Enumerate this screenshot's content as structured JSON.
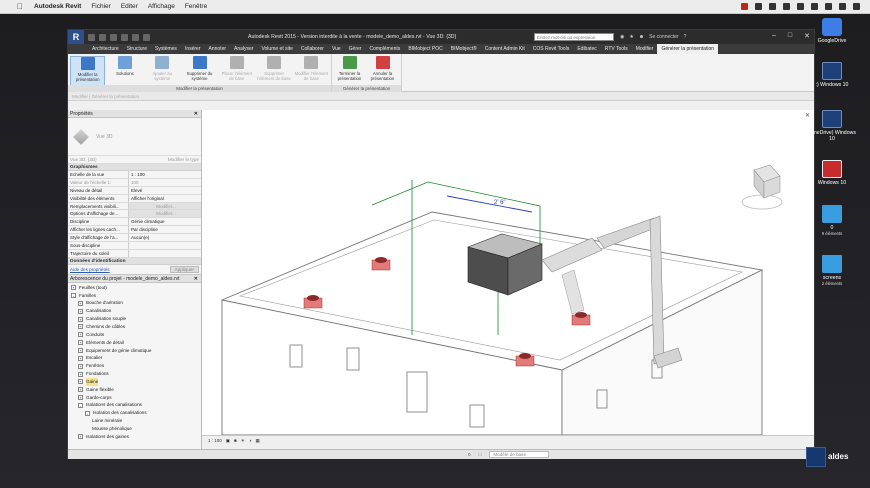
{
  "mac_menu": {
    "app_name": "Autodesk Revit",
    "items": [
      "Fichier",
      "Editer",
      "Affichage",
      "Fenêtre"
    ]
  },
  "window": {
    "title": "Autodesk Revit 2015 - Version interdite à la vente -     modele_demo_aldes.rvt - Vue 3D: {3D}",
    "search_placeholder": "Entrez mot-clé ou expression",
    "signin_label": "Se connecter"
  },
  "ribbon_tabs": [
    "Architecture",
    "Structure",
    "Systèmes",
    "Insérer",
    "Annoter",
    "Analyser",
    "Volume et site",
    "Collaborer",
    "Vue",
    "Gérer",
    "Compléments",
    "BIMobject POC",
    "BIMobject®",
    "Content Admin Kit",
    "COS Revit Tools",
    "Edibatec",
    "RTV Tools",
    "Modifier",
    "Générer la présentation"
  ],
  "active_tab_index": 18,
  "ribbon": {
    "group1": {
      "label": "Modifier la présentation",
      "buttons": [
        {
          "label": "Modifier la présentation",
          "enabled": true,
          "selected": true
        },
        {
          "label": "Solutions",
          "enabled": true
        },
        {
          "label": "Ajouter au système",
          "enabled": false
        },
        {
          "label": "Supprimer du système",
          "enabled": true
        },
        {
          "label": "Placer l'élément de base",
          "enabled": false
        },
        {
          "label": "Supprimer l'élément de base",
          "enabled": false
        },
        {
          "label": "Modifier l'élément de base",
          "enabled": false
        }
      ]
    },
    "group2": {
      "label": "Générer la présentation",
      "buttons": [
        {
          "label": "Terminer la présentation",
          "enabled": true
        },
        {
          "label": "Annuler la présentation",
          "enabled": true
        }
      ]
    },
    "options_bar": "Modifier | Générer la présentation"
  },
  "properties": {
    "header": "Propriétés",
    "type_name": "Vue 3D",
    "view_selector": "Vue 3D: {3D}",
    "edit_type_label": "Modifier le type",
    "sections": {
      "graphics": "Graphismes",
      "extents": "Données d'identification"
    },
    "rows": [
      {
        "k": "Echelle de la vue",
        "v": "1 : 100"
      },
      {
        "k": "Valeur de l'échelle   1:",
        "v": "100",
        "dim": true
      },
      {
        "k": "Niveau de détail",
        "v": "Elevé"
      },
      {
        "k": "Visibilité des éléments",
        "v": "Afficher l'original"
      },
      {
        "k": "Remplacements visibili...",
        "v": "Modifier...",
        "btn": true
      },
      {
        "k": "Options d'affichage de...",
        "v": "Modifier...",
        "btn": true
      },
      {
        "k": "Discipline",
        "v": "Génie climatique"
      },
      {
        "k": "Afficher les lignes cach...",
        "v": "Par discipline"
      },
      {
        "k": "Style d'affichage de l'a...",
        "v": "Aucun(e)"
      },
      {
        "k": "Sous-discipline",
        "v": ""
      },
      {
        "k": "Trajectoire du soleil",
        "v": ""
      }
    ],
    "help_link": "Aide des propriétés",
    "apply_label": "Appliquer"
  },
  "browser": {
    "header": "Arborescence du projet - modele_demo_aldes.rvt",
    "items": [
      {
        "label": "Feuilles (tout)",
        "level": 0,
        "tog": "+"
      },
      {
        "label": "Familles",
        "level": 0,
        "tog": "-"
      },
      {
        "label": "Bouche d'aération",
        "level": 1,
        "tog": "+"
      },
      {
        "label": "Canalisation",
        "level": 1,
        "tog": "+"
      },
      {
        "label": "Canalisation souple",
        "level": 1,
        "tog": "+"
      },
      {
        "label": "Chemins de câbles",
        "level": 1,
        "tog": "+"
      },
      {
        "label": "Conduits",
        "level": 1,
        "tog": "+"
      },
      {
        "label": "Eléments de détail",
        "level": 1,
        "tog": "+"
      },
      {
        "label": "Equipement de génie climatique",
        "level": 1,
        "tog": "+"
      },
      {
        "label": "Escalier",
        "level": 1,
        "tog": "+"
      },
      {
        "label": "Fenêtres",
        "level": 1,
        "tog": "+"
      },
      {
        "label": "Fondations",
        "level": 1,
        "tog": "+"
      },
      {
        "label": "Gaine",
        "level": 1,
        "tog": "+",
        "sel": true
      },
      {
        "label": "Gaine flexible",
        "level": 1,
        "tog": "+"
      },
      {
        "label": "Garde-corps",
        "level": 1,
        "tog": "+"
      },
      {
        "label": "Isolations des canalisations",
        "level": 1,
        "tog": "-"
      },
      {
        "label": "Isolation des canalisations",
        "level": 2,
        "tog": "-"
      },
      {
        "label": "Laine minérale",
        "level": 3,
        "tog": ""
      },
      {
        "label": "Mousse phénolique",
        "level": 3,
        "tog": ""
      },
      {
        "label": "Isolations des gaines",
        "level": 1,
        "tog": "+"
      }
    ]
  },
  "viewport": {
    "scale": "1 : 100",
    "dimension_label": "2' 6\"",
    "dim_small_1": "1.67",
    "dim_small_2": "1.00",
    "wall_tag": "aldes"
  },
  "status": {
    "model_label": "Modèle de base",
    "coord": "0"
  },
  "desktop_icons": [
    {
      "label": "GoogleDrive",
      "sub": "",
      "kind": "gdrive"
    },
    {
      "label": ":) Windows 10",
      "sub": "",
      "kind": "vm"
    },
    {
      "label": "(OneDrive) Windows 10",
      "sub": "",
      "kind": "vm"
    },
    {
      "label": "Windows 10",
      "sub": "",
      "kind": "vmred"
    },
    {
      "label": "0",
      "sub": "9 éléments",
      "kind": "folder"
    },
    {
      "label": "screens",
      "sub": "2 éléments",
      "kind": "folder"
    }
  ],
  "brand_text": "aldes",
  "colors": {
    "accent_red": "#c0392b",
    "duct_gray": "#cfcfcf",
    "selection_green": "#1a8a2a",
    "selection_blue": "#2a3fbf"
  }
}
